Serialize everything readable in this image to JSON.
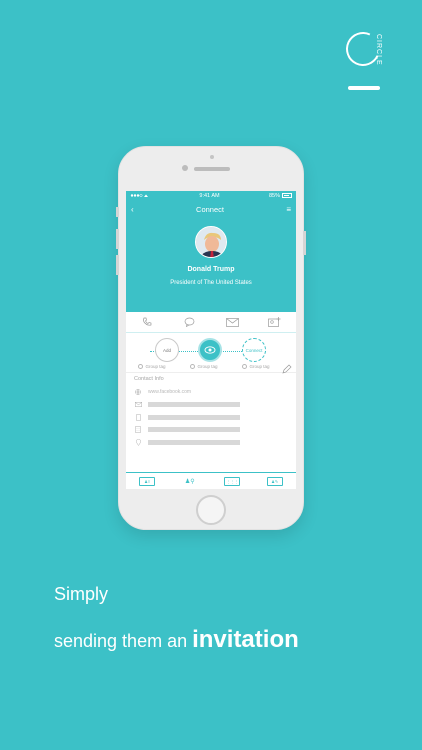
{
  "brand": {
    "logo_word": "CIRCLE"
  },
  "phone": {
    "status": {
      "time": "9:41 AM",
      "battery": "85%"
    },
    "nav": {
      "back": "‹",
      "title": "Connect",
      "menu": "≡"
    },
    "profile": {
      "name": "Donald Trump",
      "title": "President of The United States"
    },
    "flow": {
      "add_label": "Add",
      "connect_label": "Connect",
      "tags": [
        "Group tag",
        "Group tag",
        "Group tag"
      ]
    },
    "contact_info": {
      "heading": "Contact Info",
      "website": "www.facebook.com"
    }
  },
  "caption": {
    "line1": "Simply",
    "line2_prefix": "sending them an ",
    "line2_strong": "invitation"
  },
  "colors": {
    "accent": "#3cc1c7"
  }
}
